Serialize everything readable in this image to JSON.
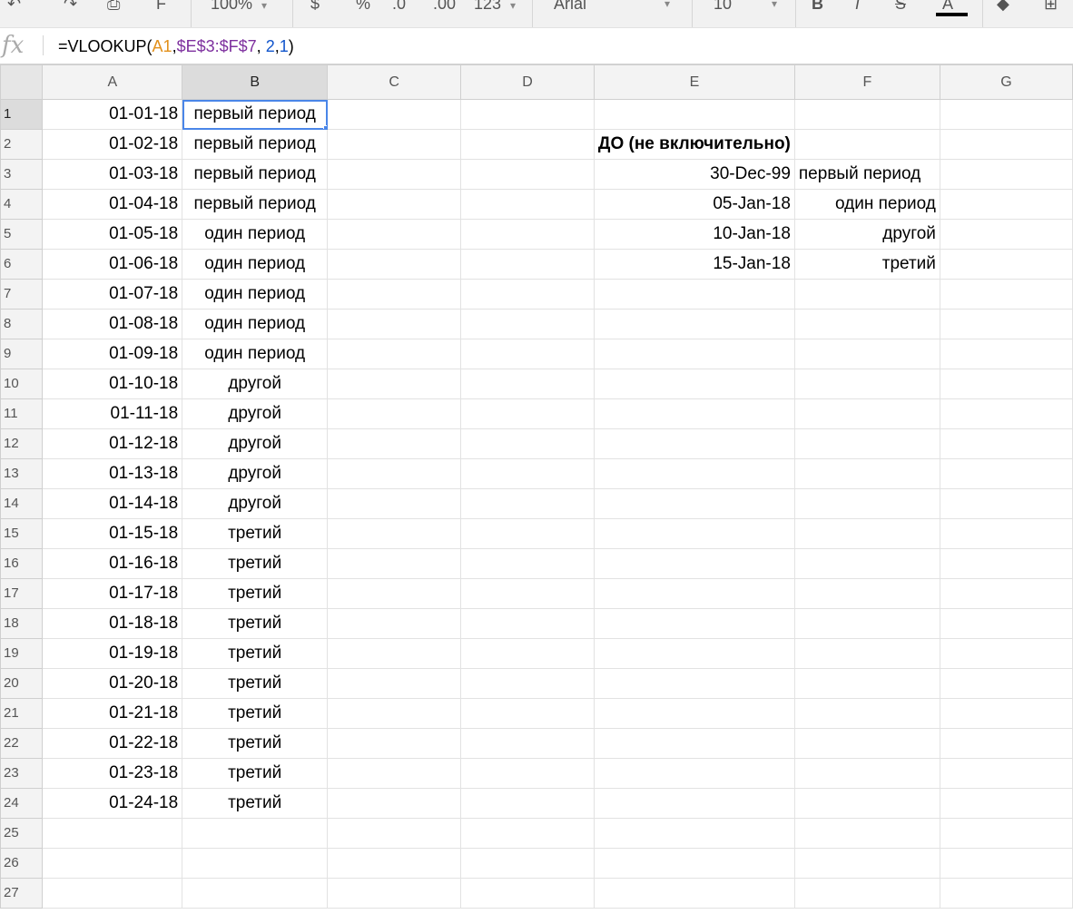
{
  "toolbar": {
    "zoom": "100%",
    "currency": "$",
    "percent": "%",
    "decrease_decimals": ".0",
    "increase_decimals": ".00",
    "number_format": "123",
    "font": "Arial",
    "font_size": "10",
    "bold": "B",
    "italic": "I",
    "strikethrough": "S",
    "text_color": "A"
  },
  "formula_bar": {
    "fx": "fx",
    "formula": {
      "prefix": "=VLOOKUP(",
      "arg1": "A1",
      "sep1": ",",
      "arg2": "$E$3:$F$7",
      "sep2": ", ",
      "arg3": "2",
      "sep3": ",",
      "arg4": "1",
      "suffix": ")"
    }
  },
  "sheet": {
    "columns": [
      "A",
      "B",
      "C",
      "D",
      "E",
      "F",
      "G"
    ],
    "rows": [
      {
        "n": "1",
        "a": "01-01-18",
        "b": "первый период",
        "e": "",
        "f": ""
      },
      {
        "n": "2",
        "a": "01-02-18",
        "b": "первый период",
        "e": "ДО (не включительно)",
        "f": ""
      },
      {
        "n": "3",
        "a": "01-03-18",
        "b": "первый период",
        "e": "30-Dec-99",
        "f": "первый период"
      },
      {
        "n": "4",
        "a": "01-04-18",
        "b": "первый период",
        "e": "05-Jan-18",
        "f": "один период"
      },
      {
        "n": "5",
        "a": "01-05-18",
        "b": "один период",
        "e": "10-Jan-18",
        "f": "другой"
      },
      {
        "n": "6",
        "a": "01-06-18",
        "b": "один период",
        "e": "15-Jan-18",
        "f": "третий"
      },
      {
        "n": "7",
        "a": "01-07-18",
        "b": "один период",
        "e": "",
        "f": ""
      },
      {
        "n": "8",
        "a": "01-08-18",
        "b": "один период",
        "e": "",
        "f": ""
      },
      {
        "n": "9",
        "a": "01-09-18",
        "b": "один период",
        "e": "",
        "f": ""
      },
      {
        "n": "10",
        "a": "01-10-18",
        "b": "другой",
        "e": "",
        "f": ""
      },
      {
        "n": "11",
        "a": "01-11-18",
        "b": "другой",
        "e": "",
        "f": ""
      },
      {
        "n": "12",
        "a": "01-12-18",
        "b": "другой",
        "e": "",
        "f": ""
      },
      {
        "n": "13",
        "a": "01-13-18",
        "b": "другой",
        "e": "",
        "f": ""
      },
      {
        "n": "14",
        "a": "01-14-18",
        "b": "другой",
        "e": "",
        "f": ""
      },
      {
        "n": "15",
        "a": "01-15-18",
        "b": "третий",
        "e": "",
        "f": ""
      },
      {
        "n": "16",
        "a": "01-16-18",
        "b": "третий",
        "e": "",
        "f": ""
      },
      {
        "n": "17",
        "a": "01-17-18",
        "b": "третий",
        "e": "",
        "f": ""
      },
      {
        "n": "18",
        "a": "01-18-18",
        "b": "третий",
        "e": "",
        "f": ""
      },
      {
        "n": "19",
        "a": "01-19-18",
        "b": "третий",
        "e": "",
        "f": ""
      },
      {
        "n": "20",
        "a": "01-20-18",
        "b": "третий",
        "e": "",
        "f": ""
      },
      {
        "n": "21",
        "a": "01-21-18",
        "b": "третий",
        "e": "",
        "f": ""
      },
      {
        "n": "22",
        "a": "01-22-18",
        "b": "третий",
        "e": "",
        "f": ""
      },
      {
        "n": "23",
        "a": "01-23-18",
        "b": "третий",
        "e": "",
        "f": ""
      },
      {
        "n": "24",
        "a": "01-24-18",
        "b": "третий",
        "e": "",
        "f": ""
      },
      {
        "n": "25",
        "a": "",
        "b": "",
        "e": "",
        "f": ""
      },
      {
        "n": "26",
        "a": "",
        "b": "",
        "e": "",
        "f": ""
      },
      {
        "n": "27",
        "a": "",
        "b": "",
        "e": "",
        "f": ""
      }
    ]
  }
}
